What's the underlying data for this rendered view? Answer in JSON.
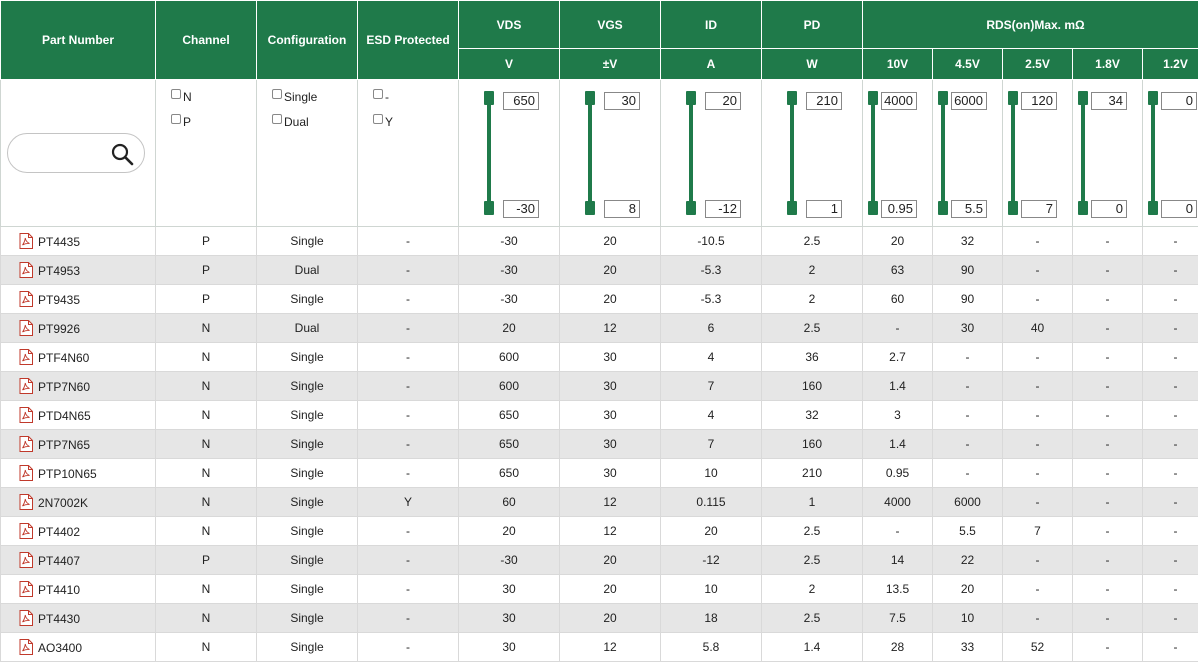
{
  "headers": {
    "part_number": "Part Number",
    "channel": "Channel",
    "configuration": "Configuration",
    "esd": "ESD Protected",
    "vds": "VDS",
    "vgs": "VGS",
    "id": "ID",
    "pd": "PD",
    "rds": "RDS(on)Max. mΩ"
  },
  "units": {
    "vds": "V",
    "vgs": "±V",
    "id": "A",
    "pd": "W",
    "rds_10v": "10V",
    "rds_45v": "4.5V",
    "rds_25v": "2.5V",
    "rds_18v": "1.8V",
    "rds_12v": "1.2V"
  },
  "search": {
    "placeholder": "",
    "value": ""
  },
  "filters": {
    "channel": [
      {
        "label": "N"
      },
      {
        "label": "P"
      }
    ],
    "configuration": [
      {
        "label": "Single"
      },
      {
        "label": "Dual"
      }
    ],
    "esd": [
      {
        "label": "-"
      },
      {
        "label": "Y"
      }
    ]
  },
  "ranges": {
    "vds": {
      "max": "650",
      "min": "-30"
    },
    "vgs": {
      "max": "30",
      "min": "8"
    },
    "id": {
      "max": "20",
      "min": "-12"
    },
    "pd": {
      "max": "210",
      "min": "1"
    },
    "rds_10v": {
      "max": "4000",
      "min": "0.95"
    },
    "rds_45v": {
      "max": "6000",
      "min": "5.5"
    },
    "rds_25v": {
      "max": "120",
      "min": "7"
    },
    "rds_18v": {
      "max": "34",
      "min": "0"
    },
    "rds_12v": {
      "max": "0",
      "min": "0"
    }
  },
  "rows": [
    [
      "PT4435",
      "P",
      "Single",
      "-",
      "-30",
      "20",
      "-10.5",
      "2.5",
      "20",
      "32",
      "-",
      "-",
      "-"
    ],
    [
      "PT4953",
      "P",
      "Dual",
      "-",
      "-30",
      "20",
      "-5.3",
      "2",
      "63",
      "90",
      "-",
      "-",
      "-"
    ],
    [
      "PT9435",
      "P",
      "Single",
      "-",
      "-30",
      "20",
      "-5.3",
      "2",
      "60",
      "90",
      "-",
      "-",
      "-"
    ],
    [
      "PT9926",
      "N",
      "Dual",
      "-",
      "20",
      "12",
      "6",
      "2.5",
      "-",
      "30",
      "40",
      "-",
      "-"
    ],
    [
      "PTF4N60",
      "N",
      "Single",
      "-",
      "600",
      "30",
      "4",
      "36",
      "2.7",
      "-",
      "-",
      "-",
      "-"
    ],
    [
      "PTP7N60",
      "N",
      "Single",
      "-",
      "600",
      "30",
      "7",
      "160",
      "1.4",
      "-",
      "-",
      "-",
      "-"
    ],
    [
      "PTD4N65",
      "N",
      "Single",
      "-",
      "650",
      "30",
      "4",
      "32",
      "3",
      "-",
      "-",
      "-",
      "-"
    ],
    [
      "PTP7N65",
      "N",
      "Single",
      "-",
      "650",
      "30",
      "7",
      "160",
      "1.4",
      "-",
      "-",
      "-",
      "-"
    ],
    [
      "PTP10N65",
      "N",
      "Single",
      "-",
      "650",
      "30",
      "10",
      "210",
      "0.95",
      "-",
      "-",
      "-",
      "-"
    ],
    [
      "2N7002K",
      "N",
      "Single",
      "Y",
      "60",
      "12",
      "0.115",
      "1",
      "4000",
      "6000",
      "-",
      "-",
      "-"
    ],
    [
      "PT4402",
      "N",
      "Single",
      "-",
      "20",
      "12",
      "20",
      "2.5",
      "-",
      "5.5",
      "7",
      "-",
      "-"
    ],
    [
      "PT4407",
      "P",
      "Single",
      "-",
      "-30",
      "20",
      "-12",
      "2.5",
      "14",
      "22",
      "-",
      "-",
      "-"
    ],
    [
      "PT4410",
      "N",
      "Single",
      "-",
      "30",
      "20",
      "10",
      "2",
      "13.5",
      "20",
      "-",
      "-",
      "-"
    ],
    [
      "PT4430",
      "N",
      "Single",
      "-",
      "30",
      "20",
      "18",
      "2.5",
      "7.5",
      "10",
      "-",
      "-",
      "-"
    ],
    [
      "AO3400",
      "N",
      "Single",
      "-",
      "30",
      "12",
      "5.8",
      "1.4",
      "28",
      "33",
      "52",
      "-",
      "-"
    ]
  ]
}
